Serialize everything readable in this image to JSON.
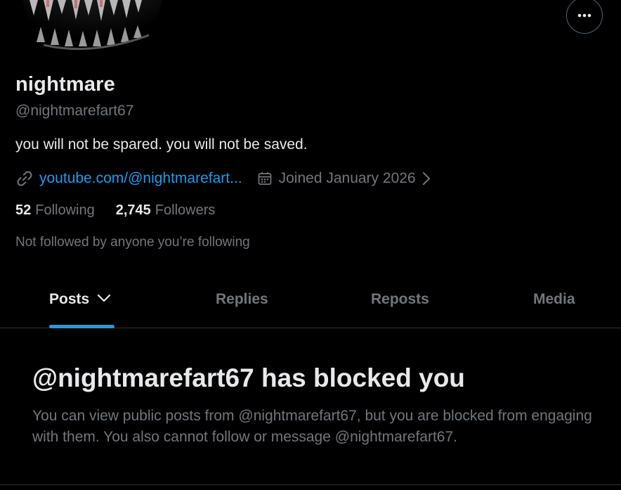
{
  "profile": {
    "display_name": "nightmare",
    "handle": "@nightmarefart67",
    "bio": "you will not be spared. you will not be saved.",
    "link_text": "youtube.com/@nightmarefart...",
    "joined": "Joined January 2026",
    "following_count": "52",
    "following_label": "Following",
    "followers_count": "2,745",
    "followers_label": "Followers",
    "not_followed_note": "Not followed by anyone you’re following"
  },
  "icons": {
    "more": "more-horizontal-icon",
    "link": "link-icon",
    "calendar": "calendar-icon",
    "chevron_right": "chevron-right-icon",
    "chevron_down": "chevron-down-icon"
  },
  "tabs": [
    {
      "label": "Posts",
      "active": true
    },
    {
      "label": "Replies",
      "active": false
    },
    {
      "label": "Reposts",
      "active": false
    },
    {
      "label": "Media",
      "active": false
    }
  ],
  "blocked": {
    "title": "@nightmarefart67 has blocked you",
    "message": "You can view public posts from @nightmarefart67, but you are blocked from engaging with them. You also cannot follow or message @nightmarefart67."
  },
  "colors": {
    "background": "#000000",
    "text_primary": "#e7e9ea",
    "text_secondary": "#71767b",
    "accent": "#1d9bf0",
    "border": "#2f3336"
  }
}
